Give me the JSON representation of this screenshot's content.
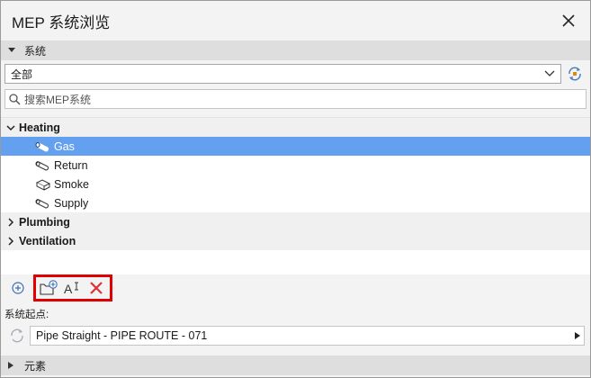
{
  "window": {
    "title": "MEP 系统浏览"
  },
  "systems_section": {
    "label": "系统"
  },
  "scope": {
    "selected": "全部"
  },
  "search": {
    "placeholder": "搜索MEP系统"
  },
  "tree": {
    "groups": [
      {
        "label": "Heating",
        "expanded": true,
        "children": [
          {
            "label": "Gas",
            "selected": true
          },
          {
            "label": "Return",
            "selected": false
          },
          {
            "label": "Smoke",
            "selected": false
          },
          {
            "label": "Supply",
            "selected": false
          }
        ]
      },
      {
        "label": "Plumbing",
        "expanded": false
      },
      {
        "label": "Ventilation",
        "expanded": false
      }
    ]
  },
  "toolbar": {
    "icons": [
      "add-circle-icon",
      "new-folder-icon",
      "rename-icon",
      "delete-icon"
    ],
    "highlight_color": "#e00000"
  },
  "origin": {
    "label": "系统起点:",
    "value": "Pipe Straight - PIPE ROUTE - 071"
  },
  "elements_section": {
    "label": "元素"
  },
  "colors": {
    "selection": "#64a0f0",
    "section_header": "#dedede",
    "delete": "#e03030"
  }
}
